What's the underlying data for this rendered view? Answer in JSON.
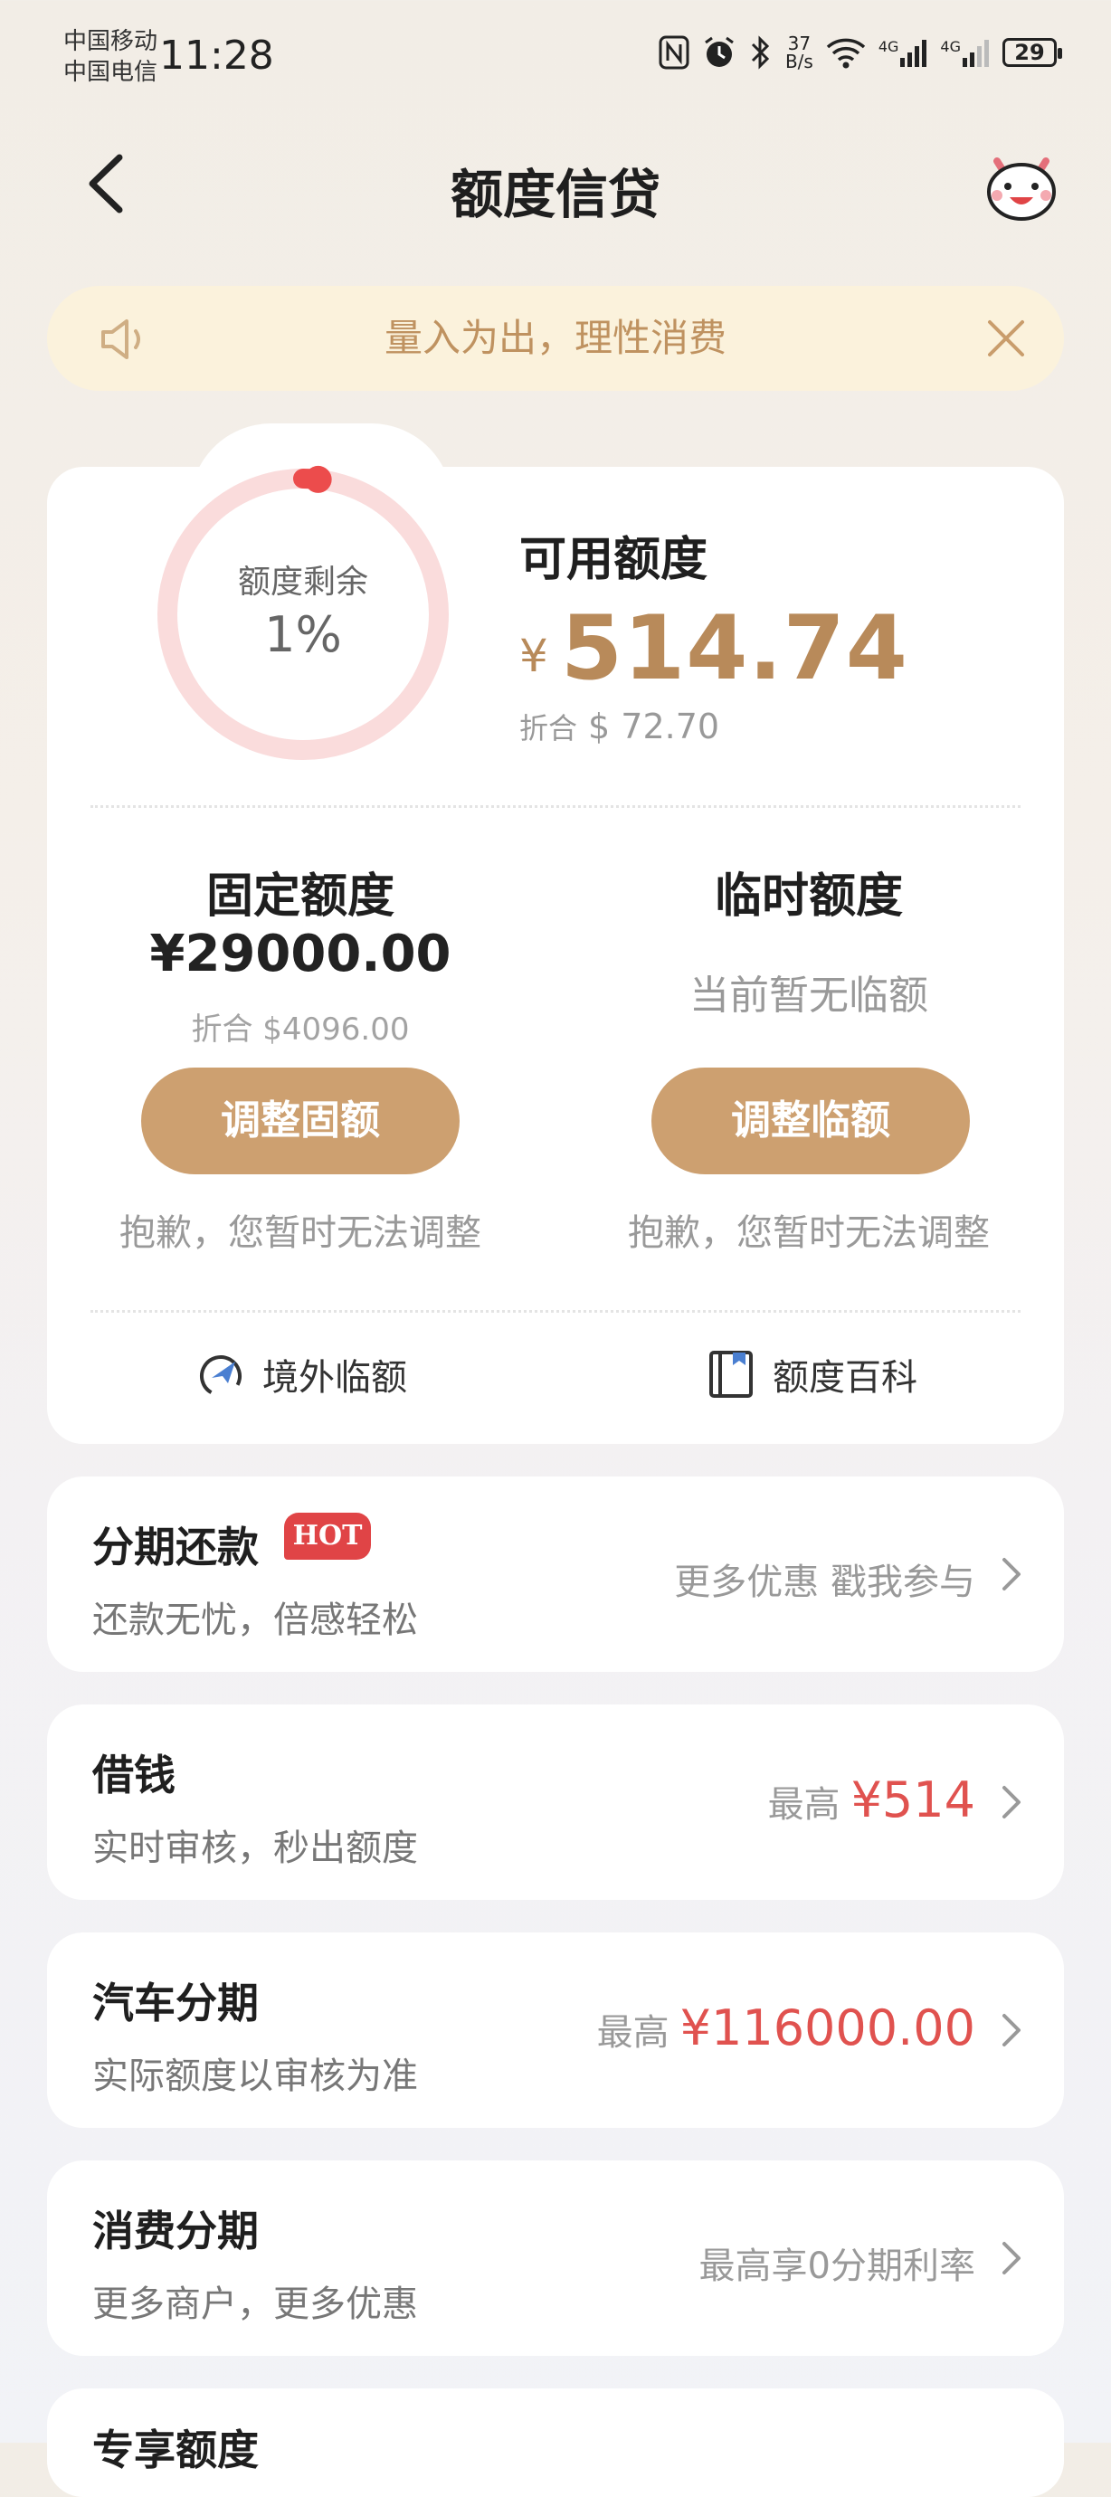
{
  "status_bar": {
    "carrier_1": "中国移动",
    "carrier_2": "中国电信",
    "time": "11:28",
    "net_speed_top": "37",
    "net_speed_bottom": "B/s",
    "net_type_1": "4G",
    "net_type_2": "4G",
    "battery": "29"
  },
  "nav": {
    "title": "额度信贷",
    "back_icon": "chevron-left-icon",
    "assistant_icon": "mascot-avatar-icon"
  },
  "notice": {
    "text": "量入为出，理性消费",
    "icon": "speaker-icon",
    "close_icon": "close-icon"
  },
  "credit": {
    "ring_label": "额度剩余",
    "ring_percent": "1%",
    "ring_fraction": 0.0177,
    "available_label": "可用额度",
    "currency_symbol": "¥",
    "available_amount": "514.74",
    "conversion_prefix": "折合",
    "conversion_value": "$ 72.70",
    "fixed": {
      "title": "固定额度",
      "amount": "¥29000.00",
      "conversion": "折合 $4096.00",
      "button": "调整固额",
      "note": "抱歉，您暂时无法调整"
    },
    "temporary": {
      "title": "临时额度",
      "status": "当前暂无临额",
      "button": "调整临额",
      "note": "抱歉，您暂时无法调整"
    },
    "links": [
      {
        "label": "境外临额",
        "icon": "plane-globe-icon"
      },
      {
        "label": "额度百科",
        "icon": "book-icon"
      }
    ]
  },
  "services": [
    {
      "title": "分期还款",
      "badge": "HOT",
      "subtitle": "还款无忧，倍感轻松",
      "right_text": "更多优惠 戳我参与",
      "highlight": ""
    },
    {
      "title": "借钱",
      "badge": "",
      "subtitle": "实时审核，秒出额度",
      "right_text": "最高",
      "highlight": "¥514"
    },
    {
      "title": "汽车分期",
      "badge": "",
      "subtitle": "实际额度以审核为准",
      "right_text": "最高",
      "highlight": "¥116000.00"
    },
    {
      "title": "消费分期",
      "badge": "",
      "subtitle": "更多商户，更多优惠",
      "right_text": "最高享0分期利率",
      "highlight": ""
    },
    {
      "title": "专享额度",
      "badge": "",
      "subtitle": "",
      "right_text": "",
      "highlight": ""
    }
  ],
  "colors": {
    "accent_gold": "#b88a5a",
    "button_gold": "#cda070",
    "notice_bg": "#fbf2dc",
    "highlight_red": "#e0524f",
    "hot_badge": "#e04446",
    "ring_track": "#fadcdc",
    "ring_progress": "#ec4c4c"
  }
}
